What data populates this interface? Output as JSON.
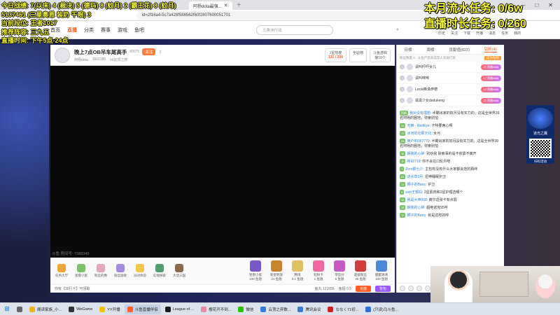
{
  "overlay_left": [
    "今日战绩: 7(以床) 4 (裁决) 5 (德玛) 8 (蚊月) 2 (霸王花) 8 (蚊月)",
    "5137461 (三星奥恩 装奶 干眼) 3",
    "当前段位: 王者1017",
    "推荐阵容: 三九五",
    "直播时间: 下午5点-24点"
  ],
  "overlay_right": [
    "本月流水任务: 0/6w",
    "直播时长任务: 0/260"
  ],
  "browser": {
    "tab_title": "阿杨dota最强...",
    "url": "id=2f16a4-5c7a428f586562f60f2807600051701"
  },
  "douyu": {
    "nav": [
      "首页",
      "直播",
      "分类",
      "赛事",
      "游戏",
      "鱼吧"
    ],
    "search_placeholder": "三角洲行动",
    "header_actions": [
      "历史",
      "关注",
      "下载",
      "开播",
      "消息",
      "任务",
      "我的"
    ]
  },
  "room": {
    "title": "晚上7点OB吊车尾高手",
    "room_id": "89075",
    "follow": "关注",
    "streamer": "阿杨dota",
    "followers": "1662185",
    "category": "lol云顶之弈",
    "hot_rank_label": "1星热度",
    "hot_rank_value": "131 / 200",
    "all_station": "全站榜",
    "fish_game": "斗鱼游戏",
    "fish_game_sub": "接10个",
    "video_caption": "斗鱼 房间号: 7388349"
  },
  "gifts_left": [
    {
      "label": "任务大厅",
      "color": "#f2a33a"
    },
    {
      "label": "星愿小屋",
      "color": "#7bc36a"
    },
    {
      "label": "粉丝的像",
      "color": "#e4a8b8"
    },
    {
      "label": "粉丝勋章",
      "color": "#a58ce0"
    },
    {
      "label": "派对体验",
      "color": "#f5c44a"
    },
    {
      "label": "幻境探索",
      "color": "#4f9e6d"
    },
    {
      "label": "大话三国",
      "color": "#8a6a4a"
    }
  ],
  "gifts_right": [
    {
      "label": "星愿小屋",
      "sub": "100 鱼翅",
      "color": "#7a58c8"
    },
    {
      "label": "新星明放",
      "sub": "21 鱼翅",
      "color": "#c8842c"
    },
    {
      "label": "腾境",
      "sub": "0.1 鱼翅",
      "color": "#e0c060"
    },
    {
      "label": "轻粉卡",
      "sub": "1 鱼翅",
      "color": "#f06aa0"
    },
    {
      "label": "带您炒",
      "sub": "6 鱼翅",
      "color": "#c85ac8"
    },
    {
      "label": "超级粉丝",
      "sub": "30 鱼翅",
      "color": "#d03c3c"
    },
    {
      "label": "鲲鲲清清",
      "sub": "100 鱼翅",
      "color": "#4c8ad8"
    }
  ],
  "bottom_bar": {
    "tip": "你有【30行卡】可领取",
    "fish_ball": "鱼丸 121656",
    "fish_fin": "鱼翅 0.5",
    "charge": "充值",
    "fans": "背包"
  },
  "chat": {
    "tabs": [
      "日榜",
      "周榜",
      "贡献值(822)",
      "钻粉(4)"
    ],
    "fan_row": "粉丝数量 5",
    "fan_row_note": "斗鱼严禁未成年人充值打赏",
    "fan_badge": "成为钻粉",
    "ranks": [
      {
        "no": "1",
        "name": "请叫吓吓女儿",
        "lv": "21 阿杨dota"
      },
      {
        "no": "2",
        "name": "请叫咪咪",
        "lv": "17 阿杨dota"
      },
      {
        "no": "3",
        "name": "Local奥洛伊德",
        "lv": "14 阿杨dota"
      },
      {
        "no": "4",
        "name": "滋滋少女dudukeng",
        "lv": "21 阿杨dota"
      }
    ],
    "messages": [
      {
        "lv": "阿杨",
        "user": "我对没有理想: ",
        "text": "半霸出家的奴月没有实力的。这是全世界39名阿杨的圈地，弥索别怕"
      },
      {
        "lv": "26",
        "user": "无赖 - RedEye: ",
        "text": "卡特要两心啊"
      },
      {
        "lv": "17",
        "user": "冰河的论那元化: ",
        "text": "女弓"
      },
      {
        "lv": "24",
        "user": "用户85067770: ",
        "text": "半霸出家的奴月没有实力的。这是全世界39名阿杨的圈地，弥索别怕"
      },
      {
        "lv": "18",
        "user": "娴我的心碎: ",
        "text": "别劝我 除索事的是不依靠不离开"
      },
      {
        "lv": "10",
        "user": "呼92719: ",
        "text": "你不会在口轮月吧"
      },
      {
        "lv": "7",
        "user": "Zero郡七少: ",
        "text": "主包有没有什么大家都会挂的羁绊"
      },
      {
        "lv": "21",
        "user": "进水草3月: ",
        "text": "扭神睡眠护卫"
      },
      {
        "lv": "12",
        "user": "狮子的Barry: ",
        "text": "护卫"
      },
      {
        "lv": "9",
        "user": "wsh王额妈: ",
        "text": "2星肌肉和2星护理选哪个"
      },
      {
        "lv": "13",
        "user": "我是大神008: ",
        "text": "掩尔这张卡有点弱"
      },
      {
        "lv": "18",
        "user": "娴我的心碎: ",
        "text": "超绝诺克95呼"
      },
      {
        "lv": "12",
        "user": "狮子的Barry: ",
        "text": "就是这样的呼"
      }
    ],
    "send": "发送"
  },
  "promo": {
    "text": "道光之翼",
    "qr_text": "扫码活动"
  },
  "taskbar": [
    {
      "label": "",
      "color": "#0078d4"
    },
    {
      "label": "",
      "color": "#666666"
    },
    {
      "label": "阁读家族_小...",
      "color": "#f0b020"
    },
    {
      "label": "WeGame",
      "color": "#333333"
    },
    {
      "label": "YY开播",
      "color": "#f2c200"
    },
    {
      "label": "斗鱼直播伴侣",
      "color": "#ff5d23"
    },
    {
      "label": "League of ...",
      "color": "#1a1a1a"
    },
    {
      "label": "樱花开不到...",
      "color": "#e88aa8"
    },
    {
      "label": "微信",
      "color": "#2dc100"
    },
    {
      "label": "云顶之弈数...",
      "color": "#3a7bd5"
    },
    {
      "label": "腾讯会议",
      "color": "#3a7bd5"
    },
    {
      "label": "ななく71初...",
      "color": "#cc2020"
    },
    {
      "label": "(只读)马斗鱼...",
      "color": "#2a6fdb"
    }
  ]
}
